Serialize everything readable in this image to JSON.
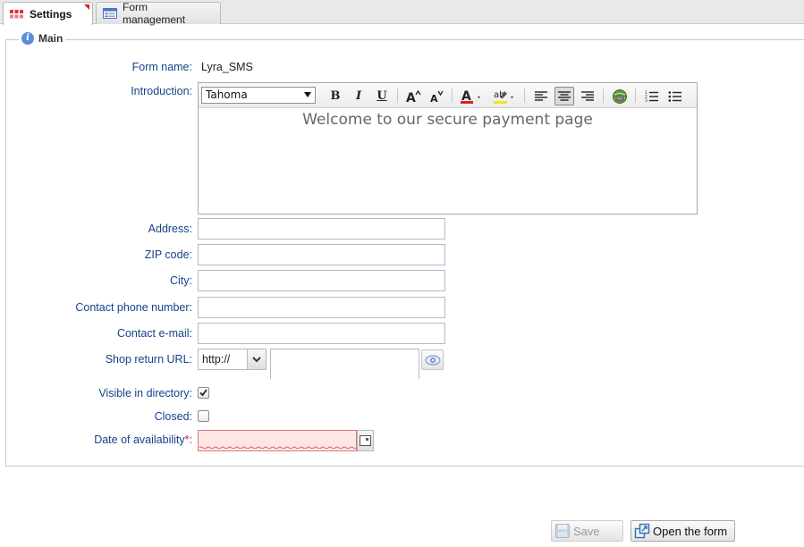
{
  "tabs": [
    {
      "label": "Settings",
      "icon": "settings-grid-icon",
      "active": true
    },
    {
      "label": "Form management",
      "icon": "form-window-icon",
      "active": false
    }
  ],
  "section": {
    "legend": "Main",
    "icon": "info-icon"
  },
  "form": {
    "form_name_label": "Form name:",
    "form_name_value": "Lyra_SMS",
    "introduction_label": "Introduction:",
    "editor": {
      "font": "Tahoma",
      "content": "Welcome to our secure payment page",
      "alignment": "center"
    },
    "address_label": "Address:",
    "address_value": "",
    "zip_label": "ZIP code:",
    "zip_value": "",
    "city_label": "City:",
    "city_value": "",
    "phone_label": "Contact phone number:",
    "phone_value": "",
    "email_label": "Contact e-mail:",
    "email_value": "",
    "shop_url_label": "Shop return URL:",
    "shop_url_protocol": "http://",
    "shop_url_value": "",
    "visible_label": "Visible in directory:",
    "visible_checked": true,
    "closed_label": "Closed:",
    "closed_checked": false,
    "date_label": "Date of availability",
    "date_required_mark": "*",
    "date_colon": ":",
    "date_value": ""
  },
  "buttons": {
    "save": "Save",
    "open_form": "Open the form"
  },
  "colors": {
    "label": "#15428b",
    "required": "#d4202c",
    "invalid_bg": "#fde6e6"
  }
}
